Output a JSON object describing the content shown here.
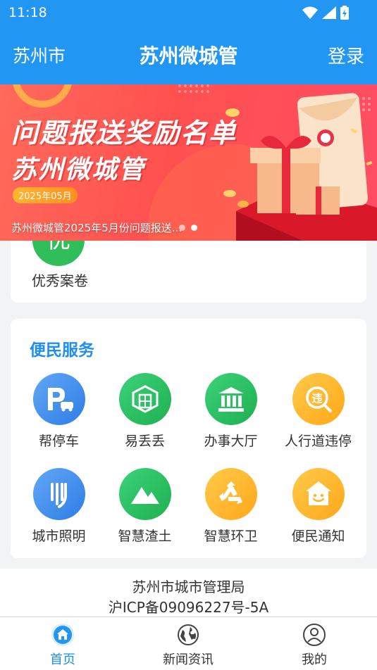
{
  "status": {
    "time": "11:18"
  },
  "header": {
    "city": "苏州市",
    "title": "苏州微城管",
    "login": "登录"
  },
  "banner": {
    "title": "问题报送奖励名单",
    "subtitle": "苏州微城管",
    "date_tag": "2025年05月",
    "caption": "苏州微城管2025年5月份问题报送...",
    "slide_count": 2,
    "active_slide": 2
  },
  "top_card": {
    "icon_char": "优",
    "label": "优秀案卷"
  },
  "services": {
    "title": "便民服务",
    "items": [
      {
        "label": "帮停车",
        "icon": "parking-icon",
        "color": "blue"
      },
      {
        "label": "易丢丢",
        "icon": "cube-icon",
        "color": "green"
      },
      {
        "label": "办事大厅",
        "icon": "hall-icon",
        "color": "green"
      },
      {
        "label": "人行道违停",
        "icon": "violation-icon",
        "color": "orange"
      },
      {
        "label": "城市照明",
        "icon": "lighting-icon",
        "color": "blue"
      },
      {
        "label": "智慧渣土",
        "icon": "mountain-icon",
        "color": "green"
      },
      {
        "label": "智慧环卫",
        "icon": "recycle-icon",
        "color": "orange"
      },
      {
        "label": "便民通知",
        "icon": "house-smile-icon",
        "color": "orange"
      }
    ]
  },
  "footer": {
    "org": "苏州市城市管理局",
    "icp": "沪ICP备09096227号-5A"
  },
  "nav": {
    "items": [
      {
        "label": "首页",
        "icon": "home-icon",
        "active": true
      },
      {
        "label": "新闻资讯",
        "icon": "globe-icon",
        "active": false
      },
      {
        "label": "我的",
        "icon": "user-icon",
        "active": false
      }
    ]
  },
  "colors": {
    "primary": "#2196f3",
    "accent_text": "#1f8ef1",
    "green": "#2fbe59",
    "orange": "#ffb62e",
    "blue": "#3a88ee"
  }
}
